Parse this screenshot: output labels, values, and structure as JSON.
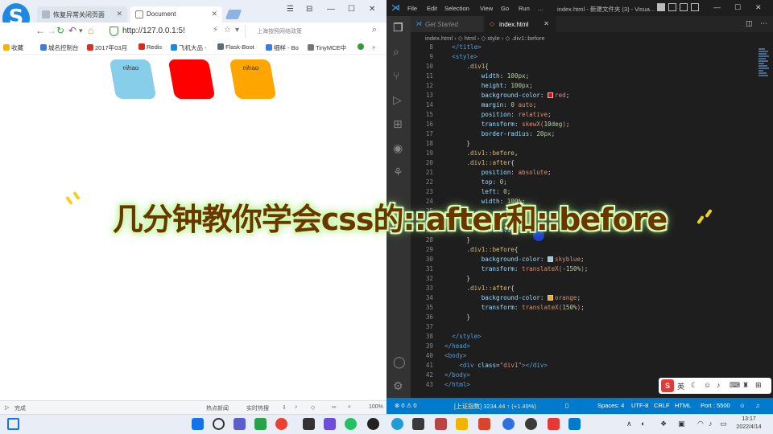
{
  "browser": {
    "tabs": [
      {
        "label": "恢复异常关闭页面"
      },
      {
        "label": "Document"
      }
    ],
    "window_controls": [
      "☰",
      "⊟",
      "—",
      "☐",
      "✕"
    ],
    "address": {
      "url": "http://127.0.0.1:5!"
    },
    "search": {
      "placeholder": "上海按照网络政策"
    },
    "bookmarks": [
      {
        "label": "收藏",
        "color": "#f5b400"
      },
      {
        "label": "城名控制台",
        "color": "#3b7ddd"
      },
      {
        "label": "2017年03月",
        "color": "#d93025"
      },
      {
        "label": "Redis",
        "color": "#d82c20"
      },
      {
        "label": "飞机大品 -",
        "color": "#1e88e5"
      },
      {
        "label": "Flask-Boot",
        "color": "#5f6b7a"
      },
      {
        "label": "细样 - Bo",
        "color": "#3b7ddd"
      },
      {
        "label": "TinyMCE中",
        "color": "#777777"
      }
    ],
    "demo": {
      "boxes": [
        {
          "text": "nihao",
          "color": "#87ceeb"
        },
        {
          "text": "",
          "color": "#ff0000"
        },
        {
          "text": "nihao",
          "color": "#ffa500"
        }
      ]
    },
    "status": {
      "left": "完成",
      "hot": "热点新闻",
      "live": "实时热搜",
      "zoom": "100%"
    }
  },
  "vscode": {
    "menu": [
      "File",
      "Edit",
      "Selection",
      "View",
      "Go",
      "Run",
      "..."
    ],
    "title": "index.html - 新建文件夹 (3) - Visua...",
    "tabs": [
      {
        "label": "Get Started",
        "icon": "⋊"
      },
      {
        "label": "index.html",
        "icon": "◇"
      }
    ],
    "breadcrumb": "index.html  ›  ◇ html  ›  ◇ style  ›  ◇ .div1::before",
    "code_lines": [
      {
        "n": "8",
        "html": "  <span class=\"tag\">&lt;/title&gt;</span>"
      },
      {
        "n": "9",
        "html": "  <span class=\"tag\">&lt;style&gt;</span>"
      },
      {
        "n": "10",
        "html": "      <span class=\"sel\">.div1</span>{"
      },
      {
        "n": "11",
        "html": "          <span class=\"prop\">width</span>: <span class=\"num\">100px</span>;"
      },
      {
        "n": "12",
        "html": "          <span class=\"prop\">height</span>: <span class=\"num\">100px</span>;"
      },
      {
        "n": "13",
        "html": "          <span class=\"prop\">background-color</span>: <span class=\"swatch\" style=\"background:#ff0000\"></span><span class=\"val\">red</span>;"
      },
      {
        "n": "14",
        "html": "          <span class=\"prop\">margin</span>: <span class=\"num\">0</span> <span class=\"val\">auto</span>;"
      },
      {
        "n": "15",
        "html": "          <span class=\"prop\">position</span>: <span class=\"val\">relative</span>;"
      },
      {
        "n": "16",
        "html": "          <span class=\"prop\">transform</span>: <span class=\"val\">skewX(</span><span class=\"num\">10deg</span><span class=\"val\">)</span>;"
      },
      {
        "n": "17",
        "html": "          <span class=\"prop\">border-radius</span>: <span class=\"num\">20px</span>;"
      },
      {
        "n": "18",
        "html": "      }"
      },
      {
        "n": "19",
        "html": "      <span class=\"sel\">.div1::before</span>,"
      },
      {
        "n": "20",
        "html": "      <span class=\"sel\">.div1::after</span>{"
      },
      {
        "n": "21",
        "html": "          <span class=\"prop\">position</span>: <span class=\"val\">absolute</span>;"
      },
      {
        "n": "22",
        "html": "          <span class=\"prop\">top</span>: <span class=\"num\">0</span>;"
      },
      {
        "n": "23",
        "html": "          <span class=\"prop\">left</span>: <span class=\"num\">0</span>;"
      },
      {
        "n": "24",
        "html": "          <span class=\"prop\">width</span>: <span class=\"num\">100%</span>;"
      },
      {
        "n": "25",
        "html": ""
      },
      {
        "n": "26",
        "html": ""
      },
      {
        "n": "27",
        "html": "          <span class=\"prop\">text-align</span>: <span class=\"val\">ce</span>"
      },
      {
        "n": "28",
        "html": "      }"
      },
      {
        "n": "29",
        "html": "      <span class=\"sel\">.div1::before</span>{"
      },
      {
        "n": "30",
        "html": "          <span class=\"prop\">background-color</span>: <span class=\"swatch\" style=\"background:#87ceeb\"></span><span class=\"val\">skyblue</span>;"
      },
      {
        "n": "31",
        "html": "          <span class=\"prop\">transform</span>: <span class=\"val\">translateX(</span><span class=\"num\">-150%</span><span class=\"val\">)</span>;"
      },
      {
        "n": "32",
        "html": "      }"
      },
      {
        "n": "33",
        "html": "      <span class=\"sel\">.div1::after</span>{"
      },
      {
        "n": "34",
        "html": "          <span class=\"prop\">background-color</span>: <span class=\"swatch\" style=\"background:#ffa500\"></span><span class=\"val\">orange</span>;"
      },
      {
        "n": "35",
        "html": "          <span class=\"prop\">transform</span>: <span class=\"val\">translateX(</span><span class=\"num\">150%</span><span class=\"val\">)</span>;"
      },
      {
        "n": "36",
        "html": "      }"
      },
      {
        "n": "37",
        "html": ""
      },
      {
        "n": "38",
        "html": "  <span class=\"tag\">&lt;/style&gt;</span>"
      },
      {
        "n": "39",
        "html": "<span class=\"tag\">&lt;/head&gt;</span>"
      },
      {
        "n": "40",
        "html": "<span class=\"tag\">&lt;body&gt;</span>"
      },
      {
        "n": "41",
        "html": "    <span class=\"tag\">&lt;div</span> <span class=\"attr\">class</span>=<span class=\"str\">\"div1\"</span><span class=\"tag\">&gt;&lt;/div&gt;</span>"
      },
      {
        "n": "42",
        "html": "<span class=\"tag\">&lt;/body&gt;</span>"
      },
      {
        "n": "43",
        "html": "<span class=\"tag\">&lt;/html&gt;</span>"
      }
    ],
    "ime": {
      "label": "英"
    },
    "status": {
      "errors": "⊗ 0 ⚠ 0",
      "ticker": "[上证指数] 3234.44 ↑ (+1.49%)",
      "spaces": "Spaces: 4",
      "encoding": "UTF-8",
      "eol": "CRLF",
      "language": "HTML",
      "port": "Port : 5500"
    }
  },
  "banner": {
    "text": "几分钟教你学会css的::after和::before"
  },
  "taskbar": {
    "clock_time": "13:17",
    "clock_date": "2022/4/14"
  }
}
